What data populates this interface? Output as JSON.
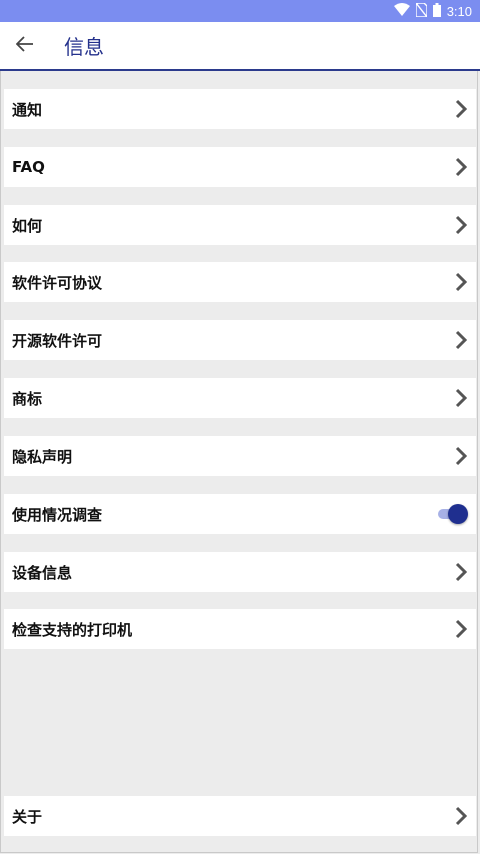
{
  "status_bar": {
    "time": "3:10"
  },
  "header": {
    "back_icon": "arrow-left-icon",
    "title": "信息"
  },
  "menu": {
    "items": [
      {
        "label": "通知",
        "control": "chevron-right-icon"
      },
      {
        "label": "FAQ",
        "control": "chevron-right-icon"
      },
      {
        "label": "如何",
        "control": "chevron-right-icon"
      },
      {
        "label": "软件许可协议",
        "control": "chevron-right-icon"
      },
      {
        "label": "开源软件许可",
        "control": "chevron-right-icon"
      },
      {
        "label": "商标",
        "control": "chevron-right-icon"
      },
      {
        "label": "隐私声明",
        "control": "chevron-right-icon"
      },
      {
        "label": "使用情况调查",
        "control": "toggle",
        "toggle_on": true
      },
      {
        "label": "设备信息",
        "control": "chevron-right-icon"
      },
      {
        "label": "检查支持的打印机",
        "control": "chevron-right-icon"
      }
    ],
    "about": {
      "label": "关于",
      "control": "chevron-right-icon"
    }
  },
  "colors": {
    "status_bar": "#7b8df0",
    "accent": "#24318c",
    "toggle_knob": "#1f2f8f",
    "toggle_track": "#a7b1e6",
    "background": "#ececec"
  }
}
